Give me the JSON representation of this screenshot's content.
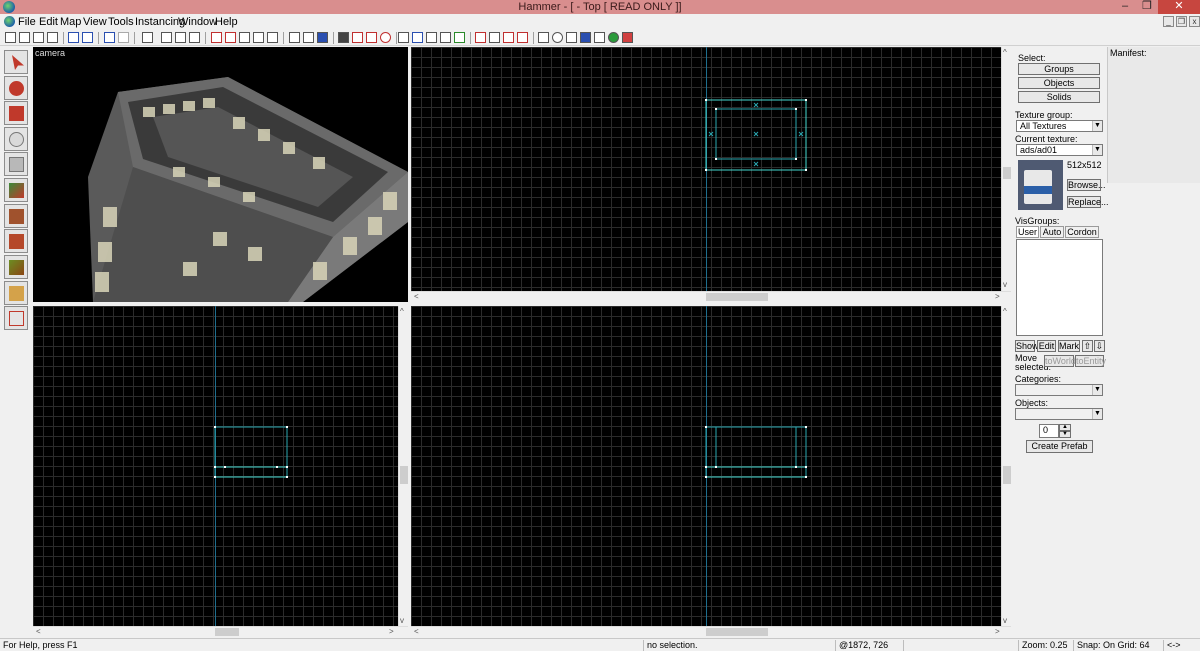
{
  "window": {
    "title": "Hammer - [ - Top [ READ ONLY ]]",
    "minimize": "–",
    "maximize": "❐",
    "close": "✕"
  },
  "menu": [
    "File",
    "Edit",
    "Map",
    "View",
    "Tools",
    "Instancing",
    "Window",
    "Help"
  ],
  "viewports": {
    "camera_label": "camera"
  },
  "right_panel": {
    "select_label": "Select:",
    "groups": "Groups",
    "objects_btn": "Objects",
    "solids": "Solids",
    "texture_group_label": "Texture group:",
    "texture_group_value": "All Textures",
    "current_texture_label": "Current texture:",
    "current_texture_value": "ads/ad01",
    "texture_size": "512x512",
    "browse": "Browse...",
    "replace": "Replace...",
    "visgroups_label": "VisGroups:",
    "tabs": [
      "User",
      "Auto",
      "Cordon"
    ],
    "show": "Show",
    "edit": "Edit",
    "mark": "Mark",
    "up": "⇧",
    "down": "⇩",
    "move_selected": "Move selected:",
    "to_world": "toWorld",
    "to_entity": "toEntity",
    "categories_label": "Categories:",
    "objects_label": "Objects:",
    "spin_value": "0",
    "create_prefab": "Create Prefab"
  },
  "manifest": {
    "label": "Manifest:"
  },
  "status": {
    "help": "For Help, press F1",
    "selection": "no selection.",
    "coords": "@1872, 726",
    "zoom": "Zoom: 0.25",
    "snap": "Snap: On Grid: 64",
    "arrows": "<->"
  },
  "colors": {
    "titlebar": "#d98e8e",
    "grid_line": "#2b2b2b",
    "axis": "#1e6e8e",
    "brush_outline": "#2aa7b0",
    "brush_cyan": "#44d9d0"
  }
}
